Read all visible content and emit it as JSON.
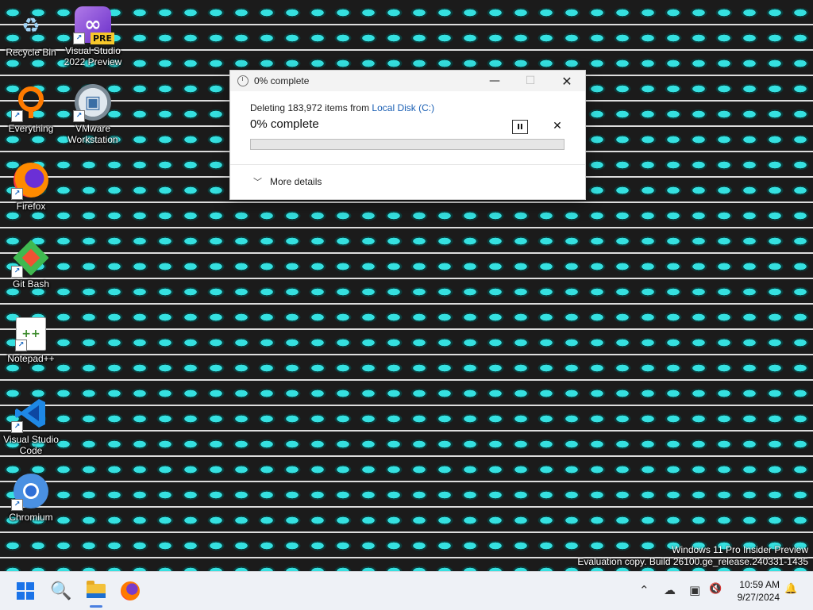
{
  "desktop_icons": [
    {
      "label_line1": "Recycle Bin",
      "label_line2": "",
      "icon": "recycle-bin-icon"
    },
    {
      "label_line1": "Visual Studio",
      "label_line2": "2022 Preview",
      "icon": "visual-studio-preview-icon",
      "badge": "PRE"
    },
    {
      "label_line1": "Everything",
      "label_line2": "",
      "icon": "everything-search-icon"
    },
    {
      "label_line1": "VMware",
      "label_line2": "Workstation",
      "icon": "vmware-icon"
    },
    {
      "label_line1": "Firefox",
      "label_line2": "",
      "icon": "firefox-icon"
    },
    {
      "label_line1": "Git Bash",
      "label_line2": "",
      "icon": "git-bash-icon"
    },
    {
      "label_line1": "Notepad++",
      "label_line2": "",
      "icon": "notepad-plus-plus-icon"
    },
    {
      "label_line1": "Visual Studio",
      "label_line2": "Code",
      "icon": "vscode-icon"
    },
    {
      "label_line1": "Chromium",
      "label_line2": "",
      "icon": "chromium-icon"
    }
  ],
  "dialog": {
    "title": "0% complete",
    "status_prefix": "Deleting 183,972 items from ",
    "location": "Local Disk (C:)",
    "percent_text": "0% complete",
    "progress_fraction": 0.0,
    "pause_glyph": "II",
    "cancel_glyph": "✕",
    "more_details": "More details",
    "min_glyph": "—",
    "max_glyph": "☐",
    "close_glyph": "✕"
  },
  "watermark": {
    "line1": "Windows 11 Pro Insider Preview",
    "line2": "Evaluation copy. Build 26100.ge_release.240331-1435"
  },
  "taskbar": {
    "time": "10:59 AM",
    "date": "9/27/2024",
    "tray_icons": [
      "chevron-up-icon",
      "onedrive-off-icon",
      "network-icon",
      "volume-mute-icon",
      "notification-bell-icon"
    ],
    "tray_glyphs": {
      "chevron": "⌃",
      "cloud": "☁",
      "network": "▣",
      "volume": "🔇",
      "bell": "🔔"
    },
    "search_glyph": "🔍"
  },
  "colors": {
    "accent": "#1a73e8",
    "link": "#1a5fb4",
    "progress": "#06b025",
    "wallpaper_pill": "#35e0e0"
  }
}
